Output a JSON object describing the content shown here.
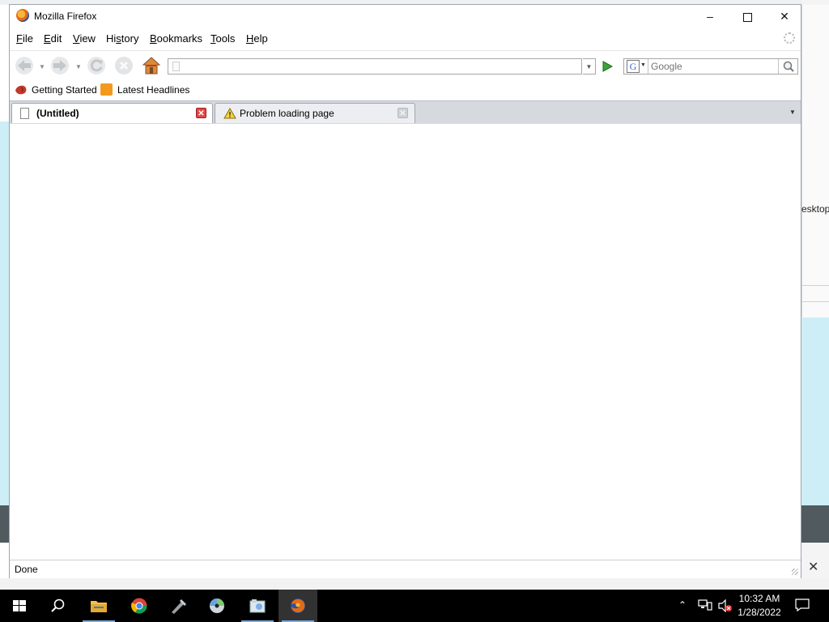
{
  "window": {
    "title": "Mozilla Firefox",
    "controls": {
      "minimize": "—",
      "close": "✕"
    }
  },
  "menu": {
    "items": [
      {
        "key": "F",
        "rest": "ile"
      },
      {
        "key": "E",
        "rest": "dit"
      },
      {
        "key": "V",
        "rest": "iew"
      },
      {
        "key": "",
        "pre": "Hi",
        "keyu": "s",
        "rest": "tory"
      },
      {
        "key": "B",
        "rest": "ookmarks"
      },
      {
        "key": "T",
        "rest": "ools"
      },
      {
        "key": "H",
        "rest": "elp"
      }
    ]
  },
  "navigation": {
    "url_value": "",
    "search_placeholder": "Google",
    "search_engine_letter": "G"
  },
  "bookmarks": {
    "items": [
      {
        "label": "Getting Started",
        "icon": "firefox-bookmark-icon"
      },
      {
        "label": "Latest Headlines",
        "icon": "rss-feed-icon"
      }
    ]
  },
  "tabs": [
    {
      "label": "(Untitled)",
      "icon": "blank-page-icon",
      "active": true
    },
    {
      "label": "Problem loading page",
      "icon": "warning-icon",
      "active": false
    }
  ],
  "status": {
    "text": "Done"
  },
  "desktop": {
    "partial_label": "esktop"
  },
  "taskbar": {
    "apps": [
      "start",
      "search",
      "file-explorer",
      "chrome",
      "tool",
      "cd",
      "package",
      "firefox"
    ],
    "clock_time": "10:32 AM",
    "clock_date": "1/28/2022"
  },
  "colors": {
    "taskbar_bg": "#000000",
    "active_task_underline": "#7aa7d6",
    "tab_close_active": "#e04848",
    "go_arrow": "#3aa63a"
  }
}
